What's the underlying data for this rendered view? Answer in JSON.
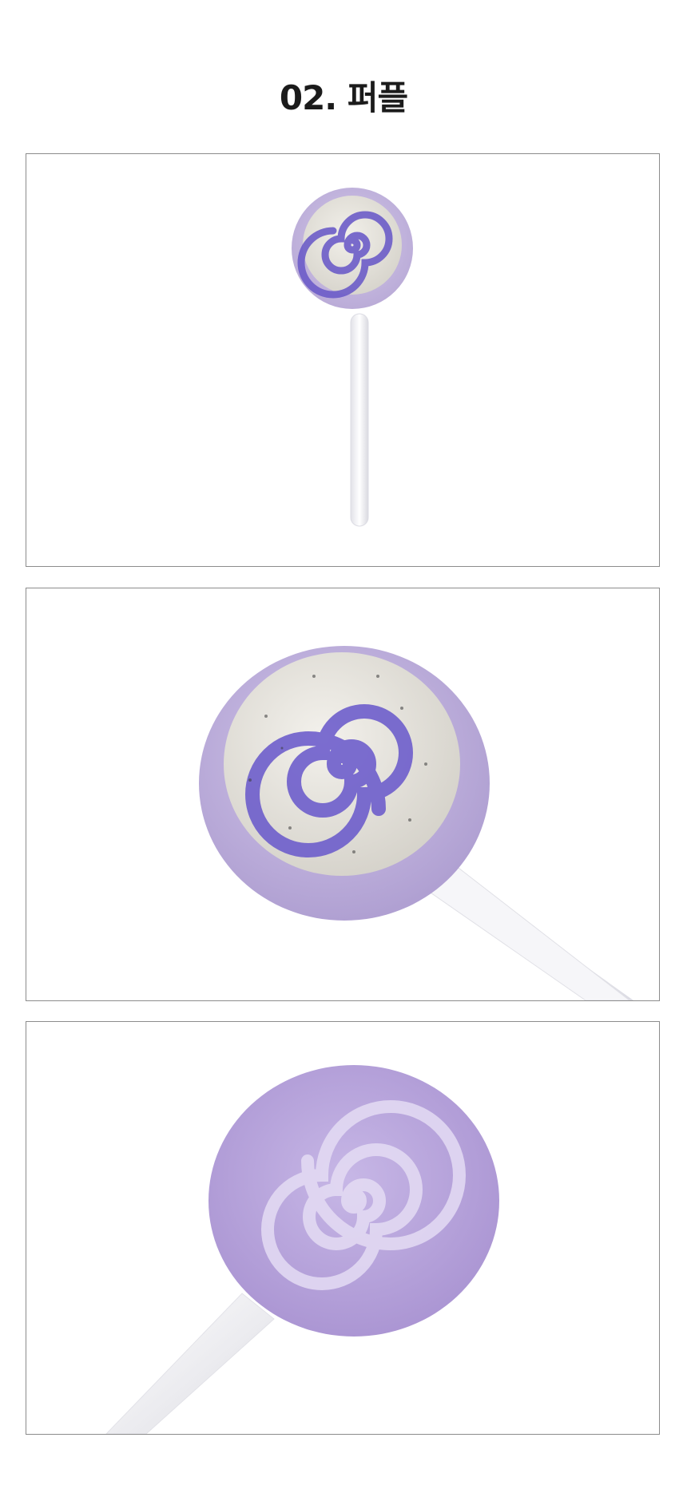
{
  "page": {
    "title": "02. 퍼플"
  },
  "colors": {
    "background": "#ffffff",
    "title": "#1b1b1b",
    "frame_border": "#8c8c8c",
    "purple_light": "#c3b5dc",
    "purple_spiral": "#6b5cc8",
    "stone": "#e7e4dc",
    "stick": "#f4f4f6"
  },
  "images": [
    {
      "name": "lollipop-full-view",
      "icon": "lollipop-icon"
    },
    {
      "name": "lollipop-stone-closeup",
      "icon": "lollipop-icon"
    },
    {
      "name": "lollipop-back-closeup",
      "icon": "lollipop-icon"
    }
  ]
}
